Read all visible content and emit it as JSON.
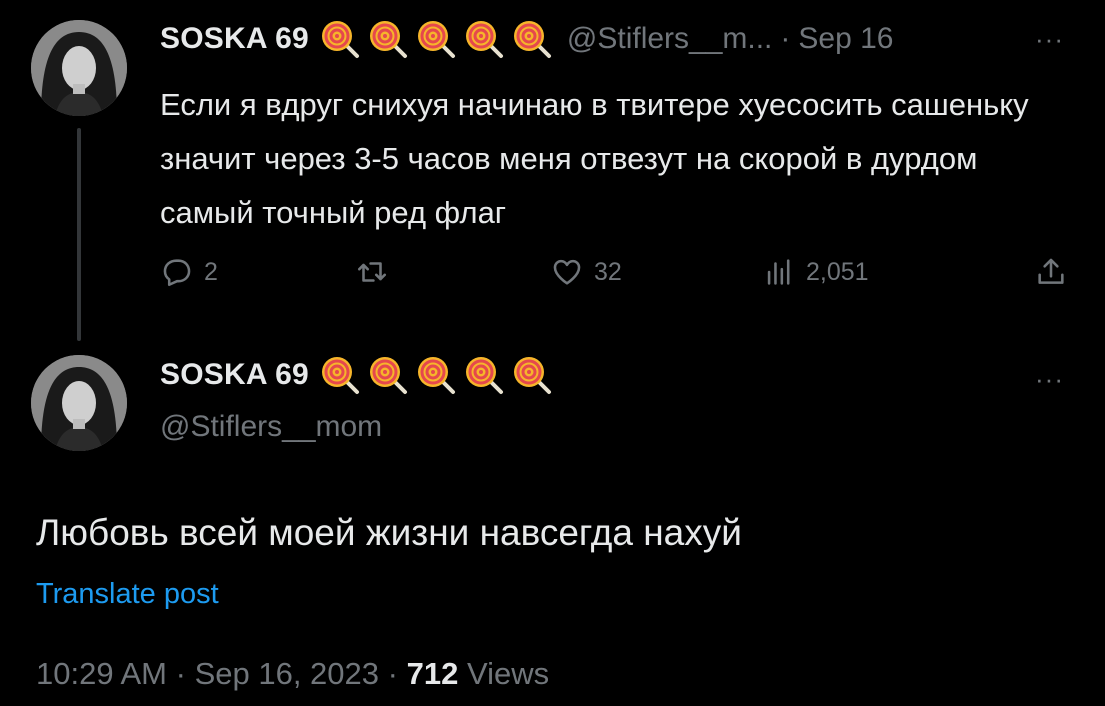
{
  "reply_parent": {
    "display_name": "SOSKA 69",
    "handle": "@Stiflers__m...",
    "separator": "·",
    "date": "Sep 16",
    "more": "···",
    "text": "Если я вдруг снихуя начинаю в твитере хуесосить сашеньку значит через 3-5 часов меня отвезут на скорой в дурдом самый точный ред флаг",
    "actions": {
      "replies": "2",
      "reposts": "",
      "likes": "32",
      "views": "2,051"
    }
  },
  "main_tweet": {
    "display_name": "SOSKA 69",
    "handle": "@Stiflers__mom",
    "more": "···",
    "text": "Любовь всей моей жизни навсегда нахуй",
    "translate": "Translate post",
    "time": "10:29 AM",
    "separator": "·",
    "date": "Sep 16, 2023",
    "views_count": "712",
    "views_label": "Views"
  },
  "emoji_icons": [
    "lollipop-icon",
    "lollipop-icon",
    "lollipop-icon",
    "lollipop-icon",
    "lollipop-icon"
  ],
  "colors": {
    "background": "#000000",
    "text": "#e7e9ea",
    "muted": "#71767b",
    "link": "#1d9bf0",
    "thread_line": "#333639"
  }
}
